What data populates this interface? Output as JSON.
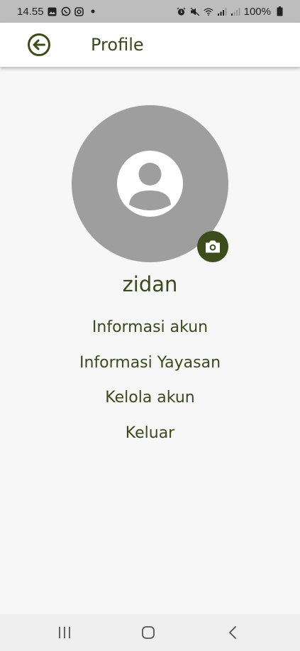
{
  "status_bar": {
    "time": "14.55",
    "battery": "100%",
    "left_icons": [
      "gallery-icon",
      "whatsapp-icon",
      "instagram-icon",
      "dot-icon"
    ],
    "right_icons": [
      "alarm-icon",
      "mute-icon",
      "wifi-icon",
      "signal-icon",
      "signal-icon",
      "battery-icon"
    ]
  },
  "app_bar": {
    "title": "Profile",
    "back_icon": "arrow-back-circle-icon"
  },
  "profile": {
    "avatar_icon": "account-circle-icon",
    "camera_icon": "camera-icon",
    "name": "zidan"
  },
  "menu": {
    "items": [
      {
        "label": "Informasi akun"
      },
      {
        "label": "Informasi Yayasan"
      },
      {
        "label": "Kelola akun"
      },
      {
        "label": "Keluar"
      }
    ]
  },
  "nav_bar": {
    "icons": [
      "recent-apps-icon",
      "home-icon",
      "back-icon"
    ]
  },
  "colors": {
    "accent": "#3d4c1c",
    "text": "#3a4a1e",
    "avatar_bg": "#9e9e9e",
    "page_bg": "#f7f7f7"
  }
}
